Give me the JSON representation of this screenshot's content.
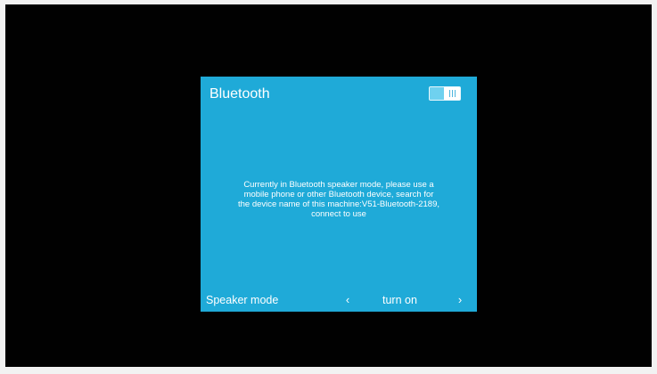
{
  "dialog": {
    "title": "Bluetooth",
    "toggle": {
      "state": "on"
    },
    "message_lines": [
      "Currently in Bluetooth speaker mode, please use a",
      "mobile phone or other Bluetooth device, search for",
      "the device name of this machine:V51-Bluetooth-2189,",
      "connect to use"
    ]
  },
  "mode_selector": {
    "label": "Speaker mode",
    "value": "turn on",
    "prev_icon": "‹",
    "next_icon": "›"
  },
  "colors": {
    "page_background": "#f2f2f2",
    "screen_background": "#010101",
    "dialog_background": "#1faad8",
    "text": "#ffffff"
  }
}
